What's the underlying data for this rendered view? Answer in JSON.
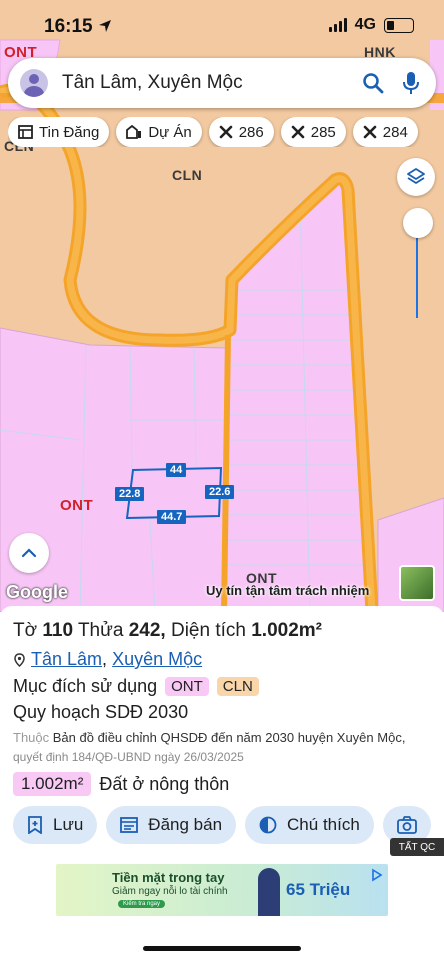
{
  "status": {
    "time": "16:15",
    "network": "4G"
  },
  "search": {
    "query": "Tân Lâm, Xuyên Mộc"
  },
  "chips": [
    {
      "label": "Tin Đăng",
      "icon": "table-icon"
    },
    {
      "label": "Dự Án",
      "icon": "building-icon"
    },
    {
      "label": "286",
      "icon": "tools-icon"
    },
    {
      "label": "285",
      "icon": "tools-icon"
    },
    {
      "label": "284",
      "icon": "tools-icon"
    }
  ],
  "map": {
    "labels": {
      "ont_top_left": "ONT",
      "hnk": "HNK",
      "cln_left": "CLN",
      "cln_center": "CLN",
      "ont_left": "ONT",
      "ont_bottom": "ONT"
    },
    "parcel": {
      "top": "44",
      "left": "22.8",
      "right": "22.6",
      "bottom": "44.7"
    },
    "google": "Google",
    "watermark": "Uy tín tận tâm trách nhiệm"
  },
  "info": {
    "sheet_label": "Tờ",
    "sheet": "110",
    "plot_label": "Thửa",
    "plot": "242,",
    "area_label": "Diện tích",
    "area": "1.002m²",
    "commune": "Tân Lâm",
    "comma": ",",
    "district": "Xuyên Mộc",
    "purpose_label": "Mục đích sử dụng",
    "purpose_tags": [
      "ONT",
      "CLN"
    ],
    "plan": "Quy hoạch SDĐ 2030",
    "desc_prefix": "Thuộc",
    "desc_text": "Bản đồ điều chỉnh QHSDĐ đến năm 2030 huyện Xuyên Mộc,",
    "desc_decision": "quyết định 184/QĐ-UBND ngày 26/03/2025",
    "area_value": "1.002m²",
    "area_type": "Đất ở nông thôn"
  },
  "actions": [
    {
      "label": "Lưu",
      "icon": "add-bookmark-icon"
    },
    {
      "label": "Đăng bán",
      "icon": "newspaper-icon"
    },
    {
      "label": "Chú thích",
      "icon": "contrast-icon"
    },
    {
      "label": "",
      "icon": "camera-icon"
    }
  ],
  "ad": {
    "tag": "TẤT QC",
    "line1": "Tiền mặt trong tay",
    "line2": "Giảm ngay nỗi lo tài chính",
    "button": "Kiểm tra ngay",
    "amount": "65 Triệu"
  },
  "colors": {
    "ont_pink": "#f8c6f6",
    "cln_tan": "#f2c9a0",
    "road_orange": "#f5a42a",
    "parcel_blue": "#1565c0",
    "link_blue": "#1a5fb4",
    "action_bg": "#dbe8f7"
  }
}
